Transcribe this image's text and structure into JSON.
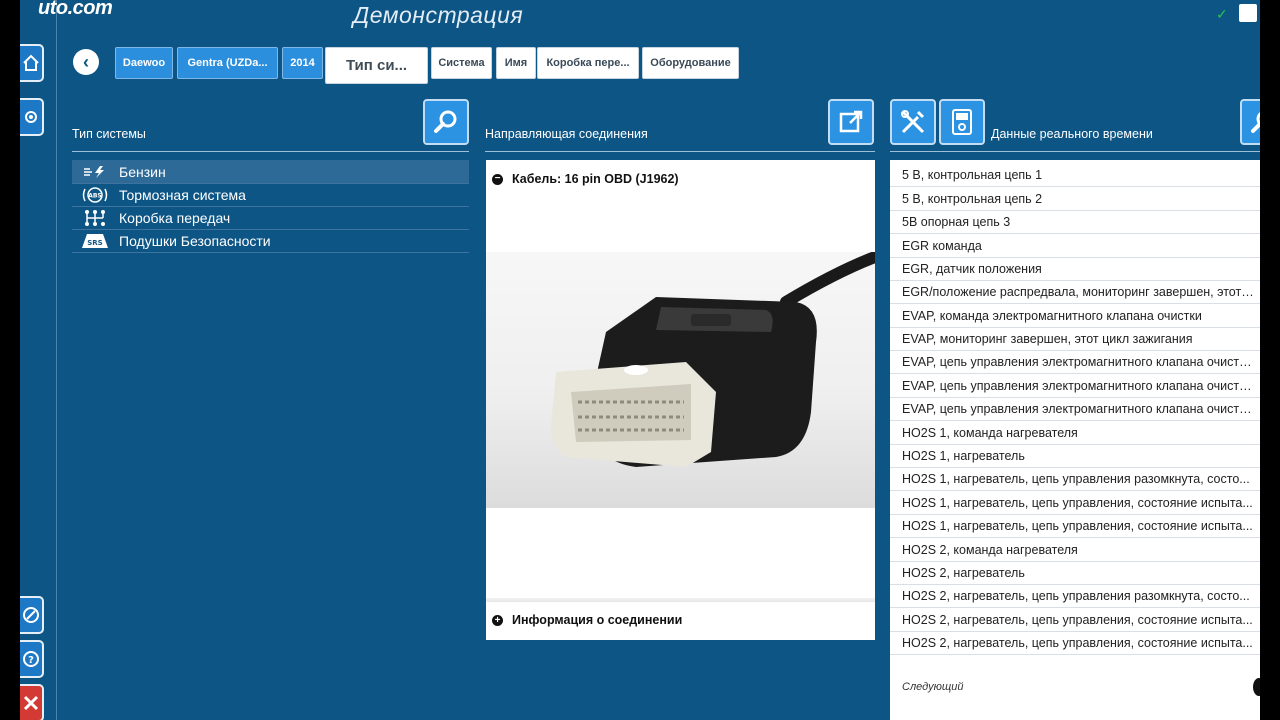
{
  "app": {
    "logo": "uto.com",
    "title": "Демонстрация"
  },
  "breadcrumb": [
    {
      "label": "Daewoo",
      "style": "blue"
    },
    {
      "label": "Gentra (UZDa...",
      "style": "blue"
    },
    {
      "label": "2014",
      "style": "blue"
    },
    {
      "label": "Тип си...",
      "style": "big"
    },
    {
      "label": "Система",
      "style": "white"
    },
    {
      "label": "Имя",
      "style": "white"
    },
    {
      "label": "Коробка пере...",
      "style": "white"
    },
    {
      "label": "Оборудование",
      "style": "white"
    }
  ],
  "system_panel": {
    "header": "Тип системы",
    "items": [
      {
        "label": "Бензин",
        "icon": "fuel-injector-icon",
        "selected": true
      },
      {
        "label": "Тормозная система",
        "icon": "abs-icon",
        "selected": false
      },
      {
        "label": "Коробка передач",
        "icon": "gearbox-icon",
        "selected": false
      },
      {
        "label": "Подушки Безопасности",
        "icon": "srs-icon",
        "selected": false
      }
    ],
    "abs_text": "ABS",
    "srs_text": "SRS"
  },
  "connection_panel": {
    "header": "Направляющая соединения",
    "cable": "Кабель: 16 pin OBD (J1962)",
    "info": "Информация о соединении"
  },
  "live_data": {
    "header": "Данные реального времени",
    "rows": [
      "5 В, контрольная цепь 1",
      "5 В, контрольная цепь 2",
      "5В опорная цепь 3",
      "EGR команда",
      "EGR, датчик положения",
      "EGR/положение распредвала, мониторинг завершен, этот ...",
      "EVAP, команда электромагнитного клапана очистки",
      "EVAP, мониторинг завершен, этот цикл зажигания",
      "EVAP, цепь управления электромагнитного клапана очистк...",
      "EVAP, цепь управления электромагнитного клапана очистк...",
      "EVAP, цепь управления электромагнитного клапана очистк...",
      "HO2S 1, команда нагревателя",
      "HO2S 1, нагреватель",
      "HO2S 1, нагреватель, цепь управления разомкнута, состо...",
      "HO2S 1, нагреватель, цепь управления, состояние испыта...",
      "HO2S 1, нагреватель, цепь управления, состояние испыта...",
      "HO2S 2, команда нагревателя",
      "HO2S 2, нагреватель",
      "HO2S 2, нагреватель, цепь управления разомкнута, состо...",
      "HO2S 2, нагреватель, цепь управления, состояние испыта...",
      "HO2S 2, нагреватель, цепь управления, состояние испыта..."
    ],
    "next": "Следующий"
  },
  "colors": {
    "background": "#0d5585",
    "accent": "#2b93e2",
    "selected_row": "#2e6a98"
  }
}
